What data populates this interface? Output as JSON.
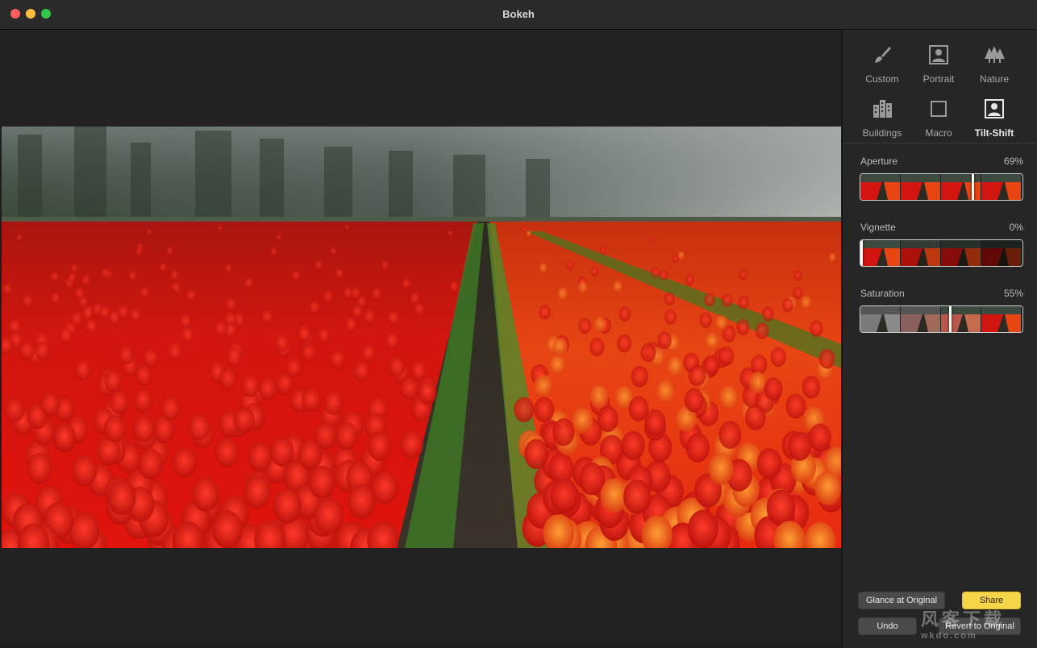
{
  "window": {
    "title": "Bokeh"
  },
  "presets": [
    {
      "label": "Custom",
      "icon": "brush-icon"
    },
    {
      "label": "Portrait",
      "icon": "portrait-icon"
    },
    {
      "label": "Nature",
      "icon": "trees-icon"
    },
    {
      "label": "Buildings",
      "icon": "buildings-icon"
    },
    {
      "label": "Macro",
      "icon": "macro-square-icon"
    },
    {
      "label": "Tilt-Shift",
      "icon": "tilt-shift-icon",
      "selected": true
    }
  ],
  "controls": {
    "aperture": {
      "label": "Aperture",
      "value_text": "69%",
      "value": 0.69
    },
    "vignette": {
      "label": "Vignette",
      "value_text": "0%",
      "value": 0.0
    },
    "saturation": {
      "label": "Saturation",
      "value_text": "55%",
      "value": 0.55
    }
  },
  "buttons": {
    "glance": "Glance at Original",
    "share": "Share",
    "undo": "Undo",
    "revert": "Revert to Original"
  },
  "watermark": {
    "main": "风客下载",
    "sub": "wkdo.com"
  },
  "colors": {
    "accent": "#f7d54a",
    "tulip_red": "#d8120e",
    "tulip_orange": "#f06a12"
  }
}
